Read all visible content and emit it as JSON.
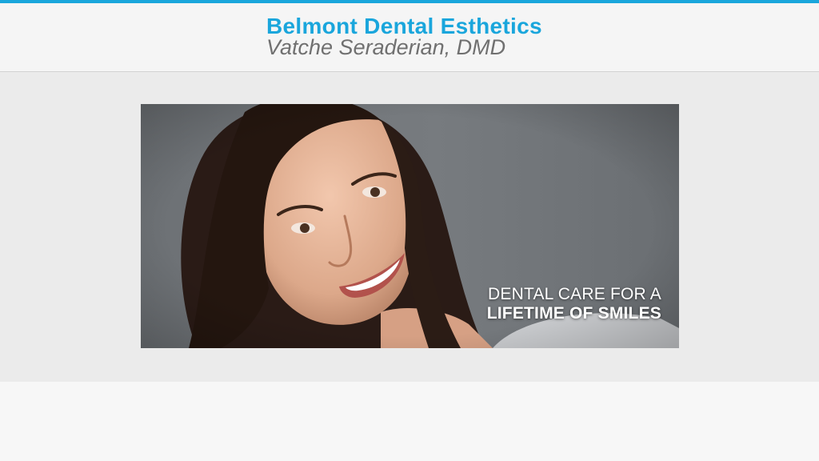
{
  "header": {
    "title": "Belmont Dental Esthetics",
    "subtitle": "Vatche Seraderian, DMD"
  },
  "hero": {
    "caption_line1": "DENTAL CARE FOR A",
    "caption_line2": "LIFETIME OF SMILES"
  },
  "colors": {
    "accent": "#1aa6dc",
    "subtitle_gray": "#707070",
    "page_background": "#f4f4f4",
    "hero_band": "#ebebeb"
  }
}
